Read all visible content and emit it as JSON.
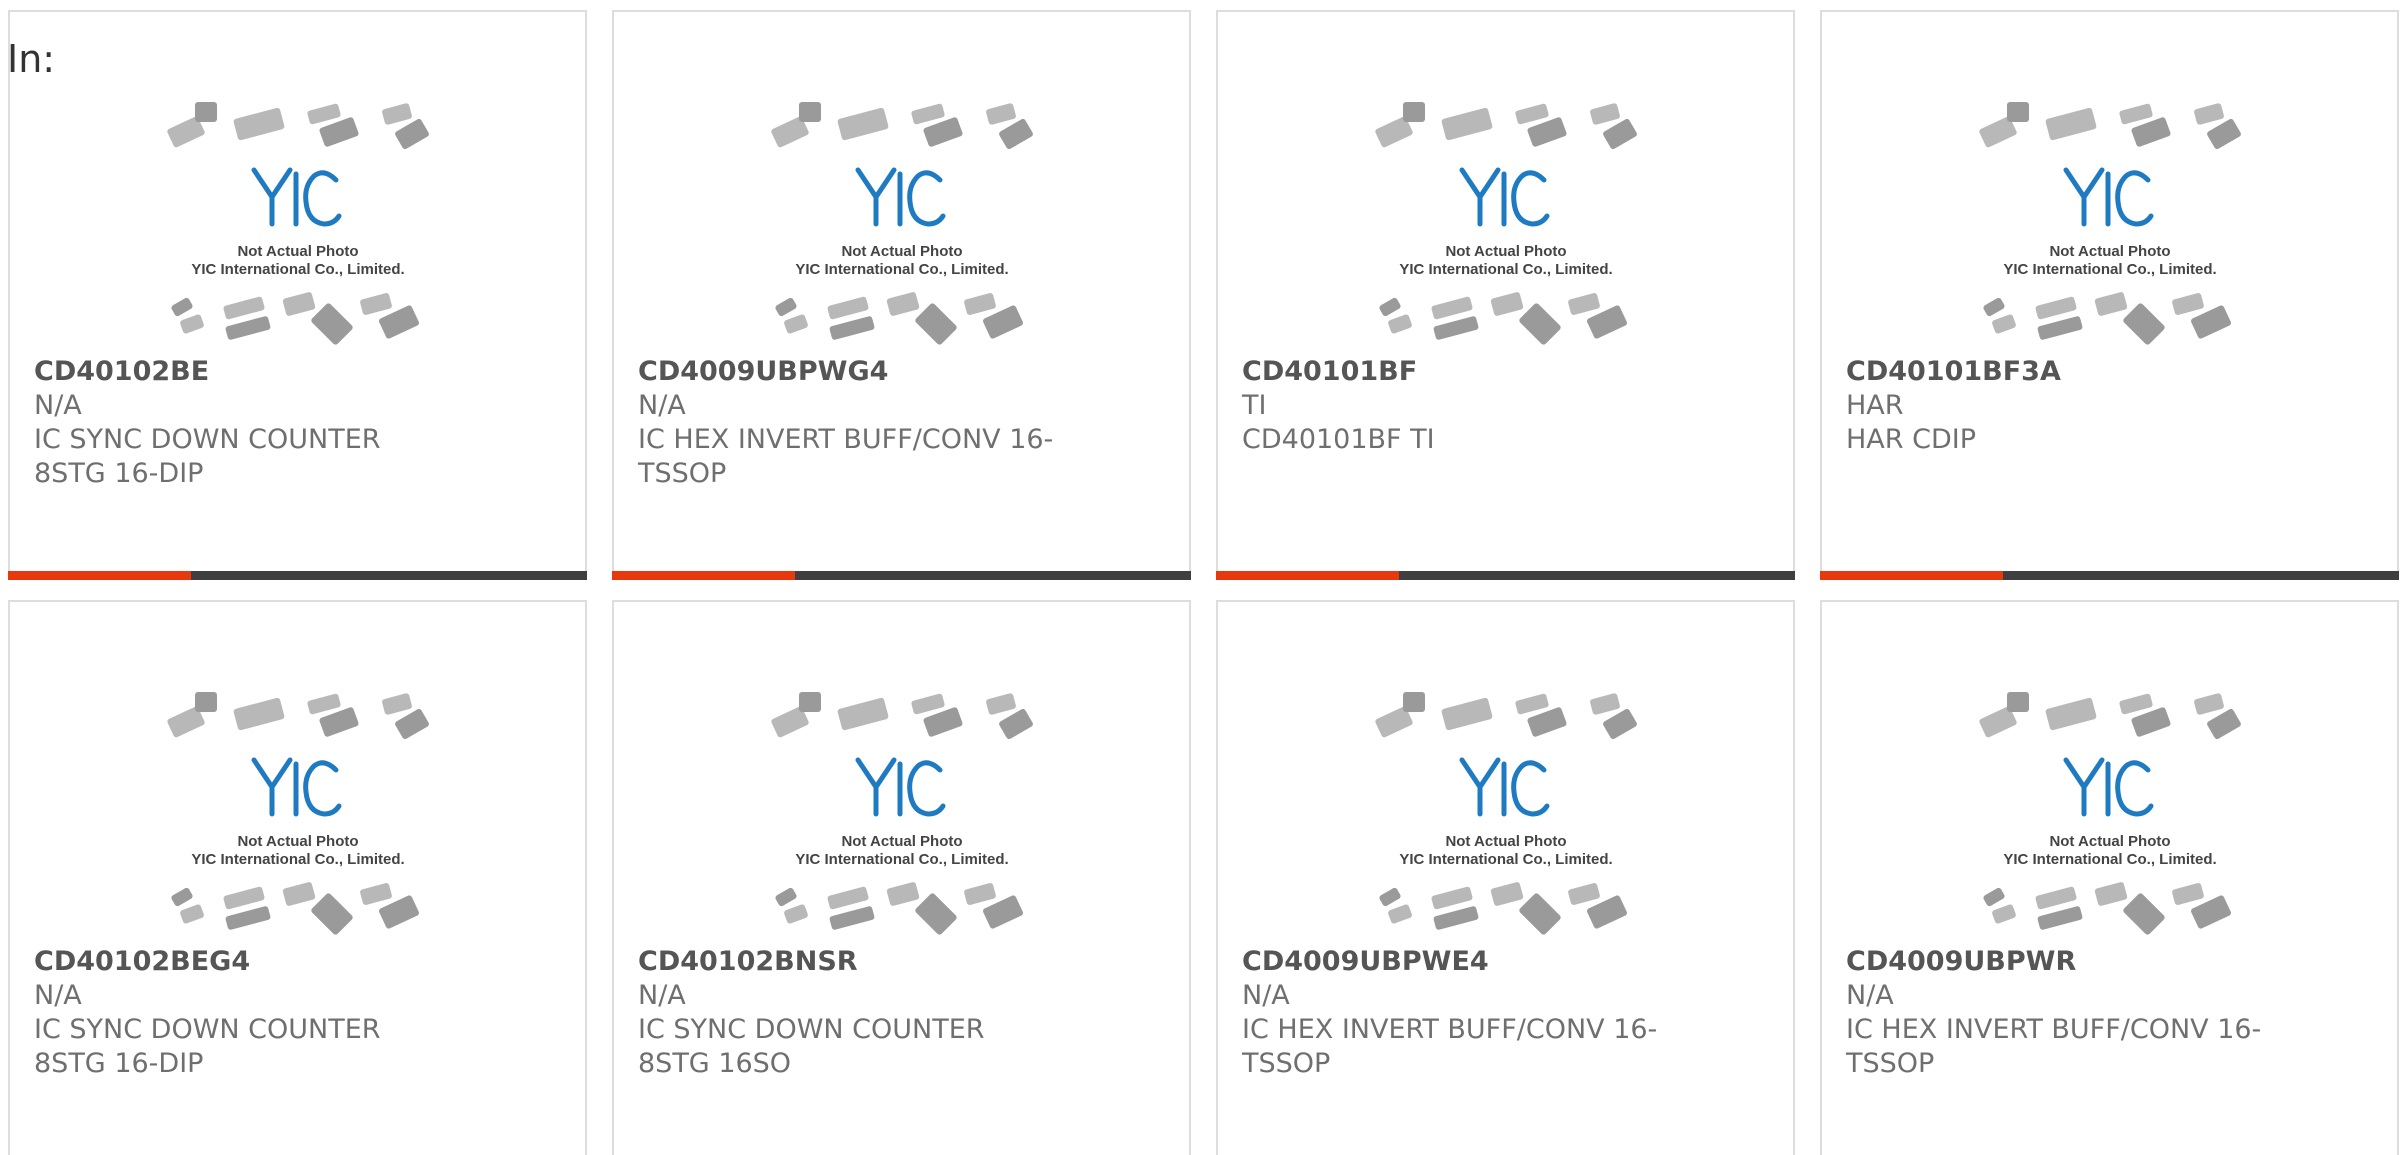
{
  "header": {
    "label": "In:"
  },
  "placeholder_image": {
    "brand": "YIC",
    "line1": "Not Actual Photo",
    "line2": "YIC International Co., Limited."
  },
  "colors": {
    "accent": "#e8380d",
    "bar_dark": "#3f3f3f",
    "logo_blue": "#1f7bc1",
    "border": "#dddddd"
  },
  "products": [
    {
      "part": "CD40102BE",
      "manufacturer": "N/A",
      "description": "IC SYNC DOWN COUNTER 8STG 16-DIP"
    },
    {
      "part": "CD4009UBPWG4",
      "manufacturer": "N/A",
      "description": "IC HEX INVERT BUFF/CONV 16-TSSOP"
    },
    {
      "part": "CD40101BF",
      "manufacturer": "TI",
      "description": "CD40101BF TI"
    },
    {
      "part": "CD40101BF3A",
      "manufacturer": "HAR",
      "description": "HAR CDIP"
    },
    {
      "part": "CD40102BEG4",
      "manufacturer": "N/A",
      "description": "IC SYNC DOWN COUNTER 8STG 16-DIP"
    },
    {
      "part": "CD40102BNSR",
      "manufacturer": "N/A",
      "description": "IC SYNC DOWN COUNTER 8STG 16SO"
    },
    {
      "part": "CD4009UBPWE4",
      "manufacturer": "N/A",
      "description": "IC HEX INVERT BUFF/CONV 16-TSSOP"
    },
    {
      "part": "CD4009UBPWR",
      "manufacturer": "N/A",
      "description": "IC HEX INVERT BUFF/CONV 16-TSSOP"
    }
  ]
}
